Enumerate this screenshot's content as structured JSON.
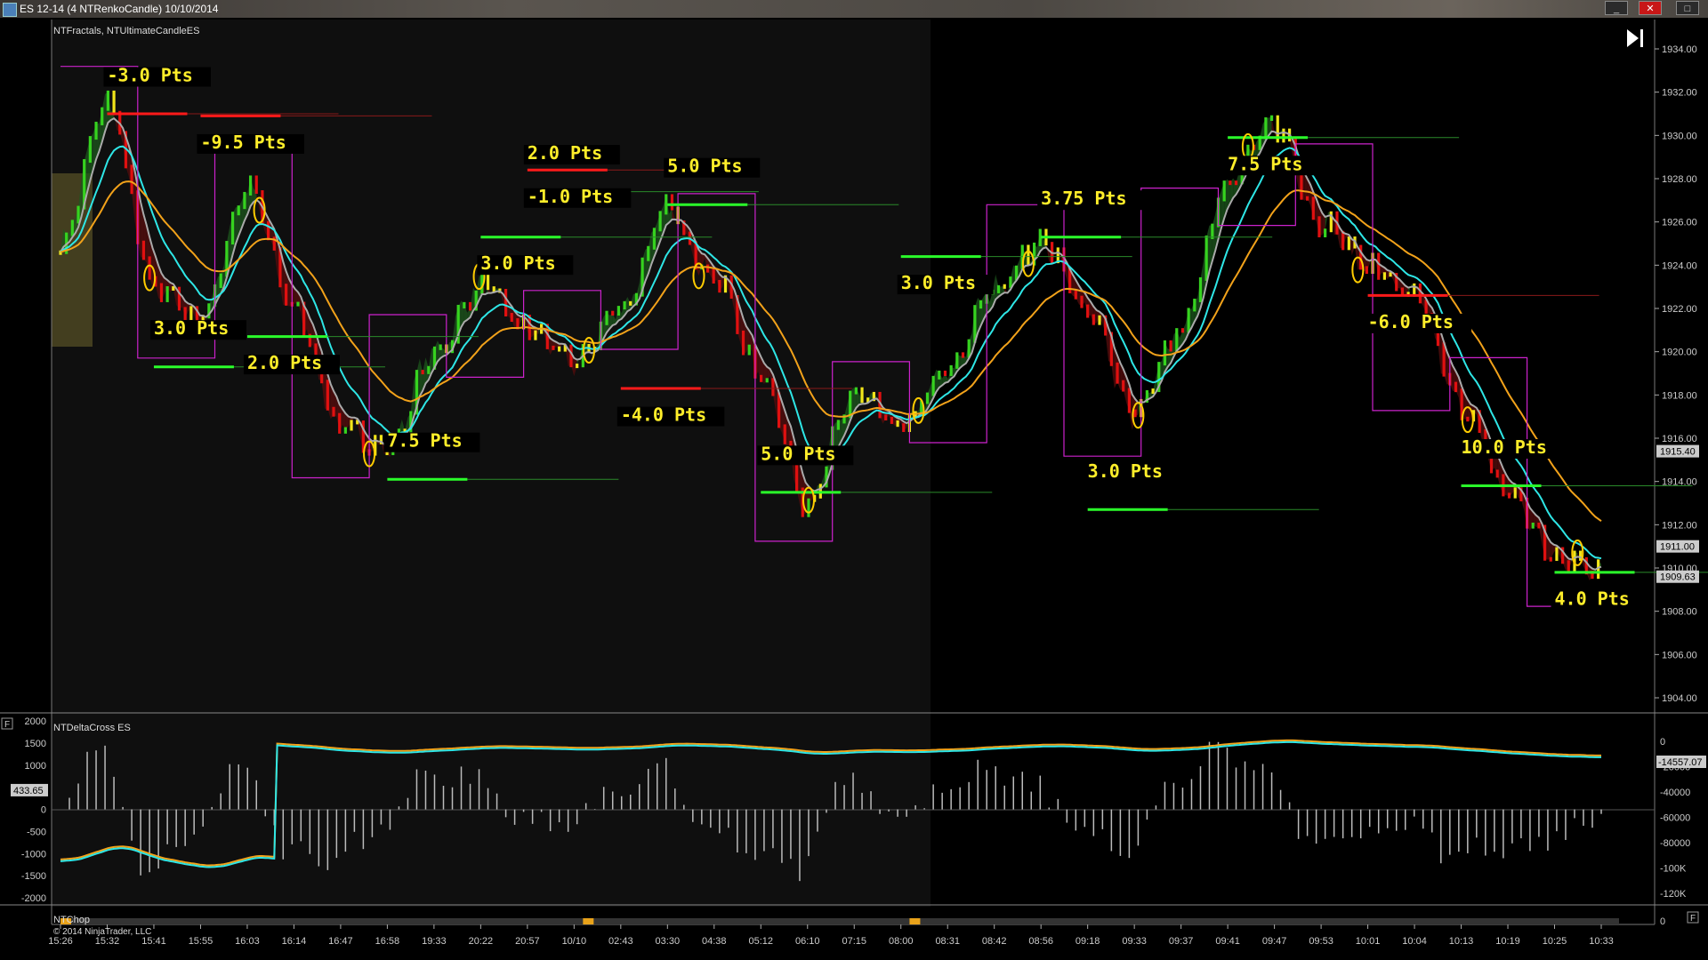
{
  "window": {
    "title": "ES 12-14 (4 NTRenkoCandle)  10/10/2014",
    "close_label": "✕",
    "max_label": "□",
    "min_label": "_"
  },
  "panels": {
    "price_indicators": "NTFractals, NTUltimateCandleES",
    "delta_indicator": "NTDeltaCross ES",
    "chop_indicator": "NTChop",
    "copyright": "© 2014 NinjaTrader, LLC",
    "panel_button": "F"
  },
  "annotations": [
    {
      "text": "-3.0  Pts",
      "x_time": "15:32",
      "price": 1932.5
    },
    {
      "text": "-9.5  Pts",
      "x_time": "15:55",
      "price": 1929.4
    },
    {
      "text": "3.0  Pts",
      "x_time": "15:41",
      "price": 1920.8
    },
    {
      "text": "2.0  Pts",
      "x_time": "16:03",
      "price": 1919.2
    },
    {
      "text": "7.5  Pts",
      "x_time": "16:58",
      "price": 1915.6
    },
    {
      "text": "3.0  Pts",
      "x_time": "20:22",
      "price": 1923.8
    },
    {
      "text": "2.0  Pts",
      "x_time": "20:57",
      "price": 1928.9
    },
    {
      "text": "-1.0  Pts",
      "x_time": "20:57",
      "price": 1926.9
    },
    {
      "text": "5.0  Pts",
      "x_time": "03:30",
      "price": 1928.3
    },
    {
      "text": "-4.0  Pts",
      "x_time": "02:43",
      "price": 1916.8
    },
    {
      "text": "5.0  Pts",
      "x_time": "05:12",
      "price": 1915.0
    },
    {
      "text": "3.0  Pts",
      "x_time": "08:00",
      "price": 1922.9
    },
    {
      "text": "3.75  Pts",
      "x_time": "08:56",
      "price": 1926.8
    },
    {
      "text": "7.5  Pts",
      "x_time": "09:41",
      "price": 1928.4
    },
    {
      "text": "3.0  Pts",
      "x_time": "09:18",
      "price": 1914.2
    },
    {
      "text": "-6.0  Pts",
      "x_time": "10:01",
      "price": 1921.1
    },
    {
      "text": "10.0  Pts",
      "x_time": "10:13",
      "price": 1915.3
    },
    {
      "text": "4.0  Pts",
      "x_time": "10:25",
      "price": 1908.3
    }
  ],
  "price_axis": {
    "labels": [
      "1934.00",
      "1932.00",
      "1930.00",
      "1928.00",
      "1926.00",
      "1924.00",
      "1922.00",
      "1920.00",
      "1918.00",
      "1916.00",
      "1914.00",
      "1912.00",
      "1910.00",
      "1908.00",
      "1906.00",
      "1904.00"
    ],
    "markers": [
      {
        "text": "1915.40",
        "price": 1915.4
      },
      {
        "text": "1911.00",
        "price": 1911.0
      },
      {
        "text": "1909.63",
        "price": 1909.6
      }
    ]
  },
  "delta_axis_left": {
    "labels": [
      "2000",
      "1500",
      "1000",
      "500",
      "0",
      "-500",
      "-1000",
      "-1500",
      "-2000"
    ],
    "marker": "433.65"
  },
  "delta_axis_right": {
    "labels": [
      "0",
      "-20000",
      "-40000",
      "-60000",
      "-80000",
      "-100K",
      "-120K"
    ],
    "marker": "-14557.07"
  },
  "chop_axis": {
    "labels": [
      "0"
    ]
  },
  "time_axis": [
    "15:26",
    "15:32",
    "15:41",
    "15:55",
    "16:03",
    "16:14",
    "16:47",
    "16:58",
    "19:33",
    "20:22",
    "20:57",
    "10/10",
    "02:43",
    "03:30",
    "04:38",
    "05:12",
    "06:10",
    "07:15",
    "08:00",
    "08:31",
    "08:42",
    "08:56",
    "09:18",
    "09:33",
    "09:37",
    "09:41",
    "09:47",
    "09:53",
    "10:01",
    "10:04",
    "10:13",
    "10:19",
    "10:25",
    "10:33"
  ],
  "colors": {
    "up_bar": "#36d31f",
    "down_bar": "#e01010",
    "neutral_bar": "#f2e51a",
    "fast_ma": "#aaaaaa",
    "cyan_ma": "#2ee6e6",
    "orange_ma": "#f2a21a",
    "fractal": "#cc22cc",
    "stop_red": "#ff1a1a",
    "target_green": "#2aff2a",
    "annotation": "#ffee2a",
    "session_shade": "#0f0f0f"
  },
  "chart_data": {
    "type": "line",
    "title": "",
    "xlabel": "",
    "ylabel": "",
    "ylim": [
      1903.0,
      1935.0
    ],
    "series": [
      {
        "name": "",
        "x": [
          "15:26",
          "15:32",
          "15:41",
          "15:55",
          "16:03",
          "16:14",
          "16:47",
          "16:58",
          "19:33",
          "20:22",
          "20:57",
          "10/10",
          "02:43",
          "03:30",
          "04:38",
          "05:12",
          "06:10",
          "07:15",
          "08:00",
          "08:31",
          "08:42",
          "08:56",
          "09:18",
          "09:33",
          "09:37",
          "09:41",
          "09:47",
          "09:53",
          "10:01",
          "10:04",
          "10:13",
          "10:19",
          "10:25",
          "10:33"
        ],
        "values": [
          1925.0,
          1931.5,
          1923.0,
          1921.5,
          1927.5,
          1922.0,
          1916.5,
          1915.5,
          1920.0,
          1923.0,
          1921.0,
          1919.5,
          1922.0,
          1926.5,
          1923.5,
          1919.0,
          1913.0,
          1918.0,
          1916.5,
          1919.0,
          1923.0,
          1925.0,
          1922.0,
          1917.0,
          1921.0,
          1928.0,
          1930.5,
          1926.0,
          1924.0,
          1922.5,
          1917.5,
          1913.5,
          1910.5,
          1910.0
        ]
      }
    ]
  }
}
